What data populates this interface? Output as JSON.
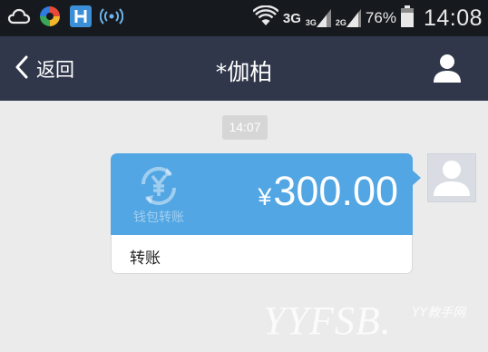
{
  "status_bar": {
    "network_label": "3G",
    "signal1_label": "3G",
    "signal2_label": "2G",
    "battery_percent": "76%",
    "time": "14:08"
  },
  "nav": {
    "back_label": "返回",
    "title": "*伽柏"
  },
  "chat": {
    "timestamp": "14:07",
    "transfer": {
      "currency_symbol": "¥",
      "amount": "300.00",
      "logo_text": "钱包转账",
      "label": "转账"
    }
  },
  "watermark": {
    "main": "YYFSB.",
    "sub": "YY教手网"
  },
  "colors": {
    "status_bar_bg": "#161a1e",
    "nav_bg": "#30374a",
    "chat_bg": "#ebebeb",
    "bubble_blue": "#52a6e3"
  }
}
